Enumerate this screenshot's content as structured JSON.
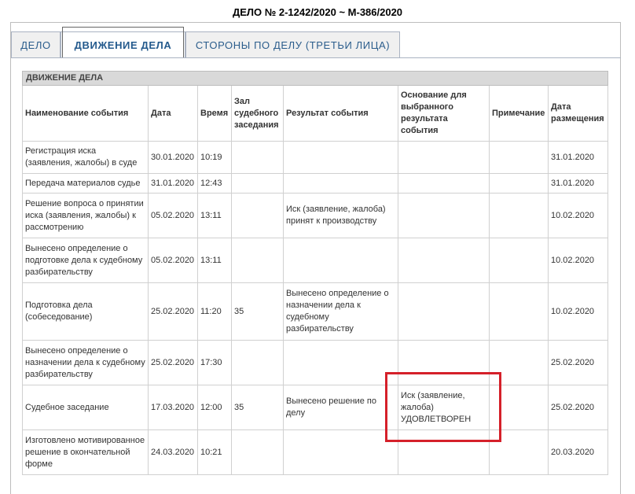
{
  "case": {
    "title": "ДЕЛО № 2-1242/2020 ~ М-386/2020"
  },
  "tabs": [
    {
      "label": "ДЕЛО",
      "active": false
    },
    {
      "label": "ДВИЖЕНИЕ ДЕЛА",
      "active": true
    },
    {
      "label": "СТОРОНЫ ПО ДЕЛУ (ТРЕТЬИ ЛИЦА)",
      "active": false
    }
  ],
  "movement": {
    "caption": "ДВИЖЕНИЕ ДЕЛА",
    "columns": [
      "Наименование события",
      "Дата",
      "Время",
      "Зал судебного заседания",
      "Результат события",
      "Основание для выбранного результата события",
      "Примечание",
      "Дата размещения"
    ],
    "rows": [
      [
        "Регистрация иска (заявления, жалобы) в суде",
        "30.01.2020",
        "10:19",
        "",
        "",
        "",
        "",
        "31.01.2020"
      ],
      [
        "Передача материалов судье",
        "31.01.2020",
        "12:43",
        "",
        "",
        "",
        "",
        "31.01.2020"
      ],
      [
        "Решение вопроса о принятии иска (заявления, жалобы) к рассмотрению",
        "05.02.2020",
        "13:11",
        "",
        "Иск (заявление, жалоба) принят к производству",
        "",
        "",
        "10.02.2020"
      ],
      [
        "Вынесено определение о подготовке дела к судебному разбирательству",
        "05.02.2020",
        "13:11",
        "",
        "",
        "",
        "",
        "10.02.2020"
      ],
      [
        "Подготовка дела (собеседование)",
        "25.02.2020",
        "11:20",
        "35",
        "Вынесено определение о назначении дела к судебному разбирательству",
        "",
        "",
        "10.02.2020"
      ],
      [
        "Вынесено определение о назначении дела к судебному разбирательству",
        "25.02.2020",
        "17:30",
        "",
        "",
        "",
        "",
        "25.02.2020"
      ],
      [
        "Судебное заседание",
        "17.03.2020",
        "12:00",
        "35",
        "Вынесено решение по делу",
        "Иск (заявление, жалоба) УДОВЛЕТВОРЕН",
        "",
        "25.02.2020"
      ],
      [
        "Изготовлено мотивированное решение в окончательной форме",
        "24.03.2020",
        "10:21",
        "",
        "",
        "",
        "",
        "20.03.2020"
      ]
    ]
  },
  "colors": {
    "tab_text": "#2b5d8c",
    "highlight": "#d5202a",
    "caption_bg": "#d9d9d9"
  }
}
